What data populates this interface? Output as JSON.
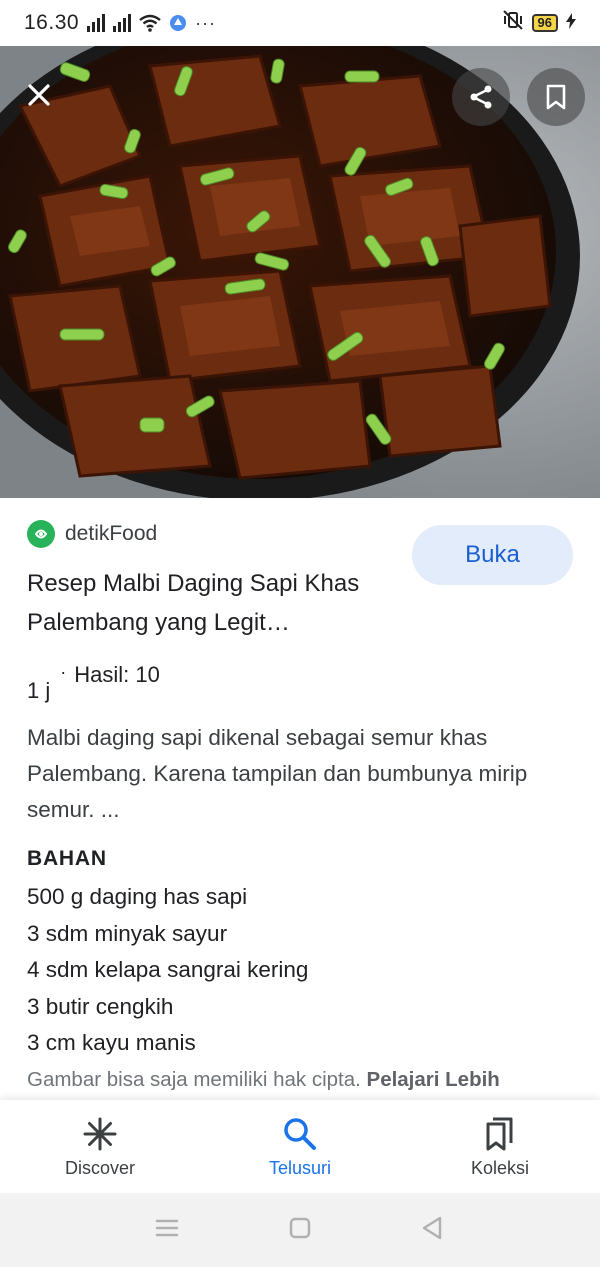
{
  "status_bar": {
    "time": "16.30",
    "battery": "96",
    "overflow": "···"
  },
  "source": {
    "name": "detikFood"
  },
  "open_button": "Buka",
  "recipe": {
    "title": "Resep Malbi Daging Sapi Khas Palembang yang Legit…",
    "time": "1 j",
    "separator": "·",
    "yield": "Hasil: 10",
    "description": "Malbi daging sapi dikenal sebagai semur khas Palembang. Karena tampilan dan bumbunya mirip semur. ...",
    "ingredients_heading": "BAHAN",
    "ingredients": [
      "500 g daging has sapi",
      "3 sdm minyak sayur",
      "4 sdm kelapa sangrai kering",
      "3 butir cengkih",
      "3 cm kayu manis"
    ]
  },
  "copyright": {
    "text": "Gambar bisa saja memiliki hak cipta. ",
    "link": "Pelajari Lebih"
  },
  "bottom_nav": {
    "items": [
      {
        "label": "Discover",
        "icon": "asterisk-icon"
      },
      {
        "label": "Telusuri",
        "icon": "search-icon",
        "active": true
      },
      {
        "label": "Koleksi",
        "icon": "collections-icon"
      }
    ]
  },
  "colors": {
    "accent": "#1a73e8",
    "open_button_bg": "#e3ecfa",
    "source_logo": "#28b35a"
  }
}
